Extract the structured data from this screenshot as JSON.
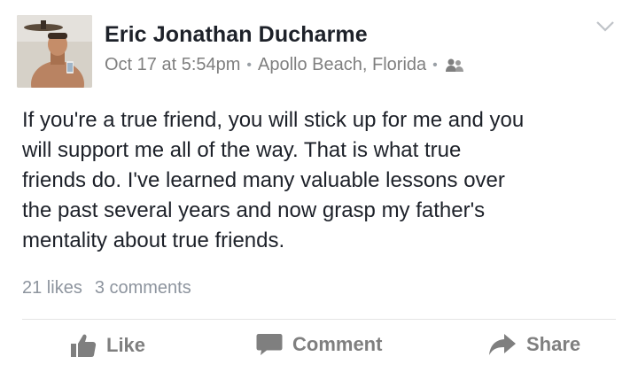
{
  "post": {
    "author": {
      "name": "Eric Jonathan Ducharme",
      "avatar_icon": "profile-photo"
    },
    "meta": {
      "date": "Oct 17 at 5:54pm",
      "separator": "•",
      "location": "Apollo Beach, Florida",
      "audience_icon": "friends-icon"
    },
    "menu_icon": "chevron-down-icon",
    "text": "If you're a true friend, you will stick up for me and you\nwill support me all of the way. That is what true\nfriends do. I've learned many valuable lessons over\nthe past several years and now grasp my father's\nmentality about true friends.",
    "stats": {
      "likes": "21 likes",
      "comments": "3 comments"
    },
    "actions": {
      "like": "Like",
      "comment": "Comment",
      "share": "Share"
    }
  },
  "colors": {
    "text_primary": "#1d2129",
    "text_secondary": "#7f7f7f",
    "divider": "#e5e5e5"
  }
}
